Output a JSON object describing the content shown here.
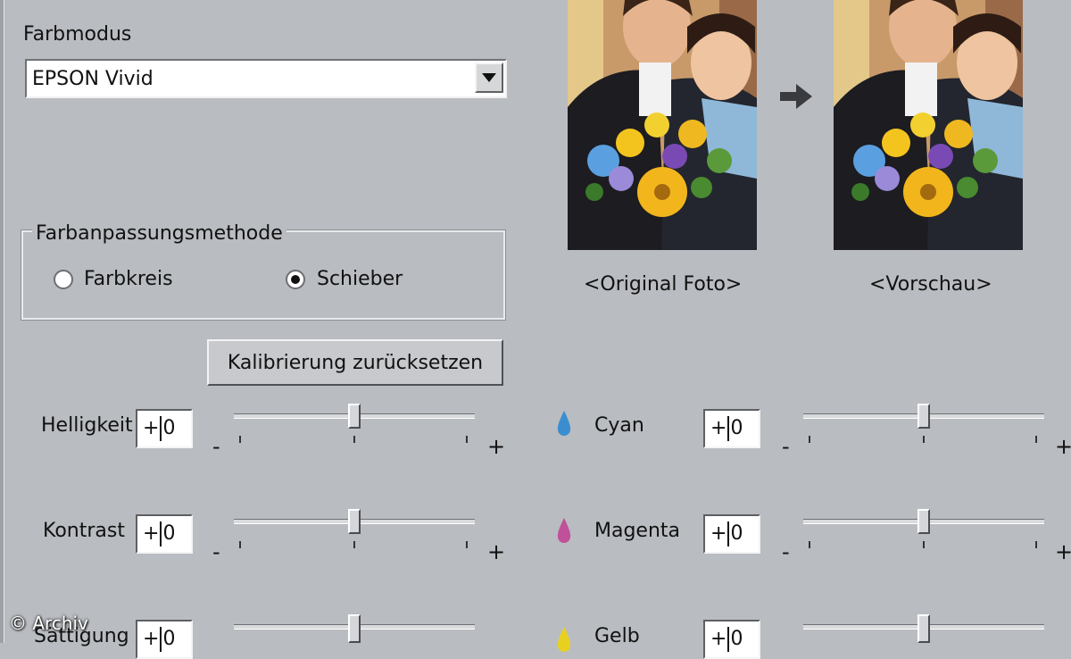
{
  "color_mode": {
    "label": "Farbmodus",
    "selected": "EPSON Vivid"
  },
  "matching_method": {
    "legend": "Farbanpassungsmethode",
    "options": [
      {
        "label": "Farbkreis",
        "selected": false
      },
      {
        "label": "Schieber",
        "selected": true
      }
    ]
  },
  "reset_button": "Kalibrierung zurücksetzen",
  "previews": {
    "original_caption": "<Original Foto>",
    "preview_caption": "<Vorschau>"
  },
  "left_sliders": [
    {
      "label": "Helligkeit",
      "value": "+0",
      "level": 0
    },
    {
      "label": "Kontrast",
      "value": "+0",
      "level": 0
    },
    {
      "label": "Sättigung",
      "value": "+0",
      "level": 0
    }
  ],
  "right_sliders": [
    {
      "label": "Cyan",
      "value": "+0",
      "level": 0,
      "icon": "cyan-drop-icon",
      "color": "#3a8ed0"
    },
    {
      "label": "Magenta",
      "value": "+0",
      "level": 0,
      "icon": "magenta-drop-icon",
      "color": "#c0509a"
    },
    {
      "label": "Gelb",
      "value": "+0",
      "level": 0,
      "icon": "yellow-drop-icon",
      "color": "#e8d020"
    }
  ],
  "slider_signs": {
    "minus": "-",
    "plus": "+"
  },
  "watermark": "© Archiv"
}
